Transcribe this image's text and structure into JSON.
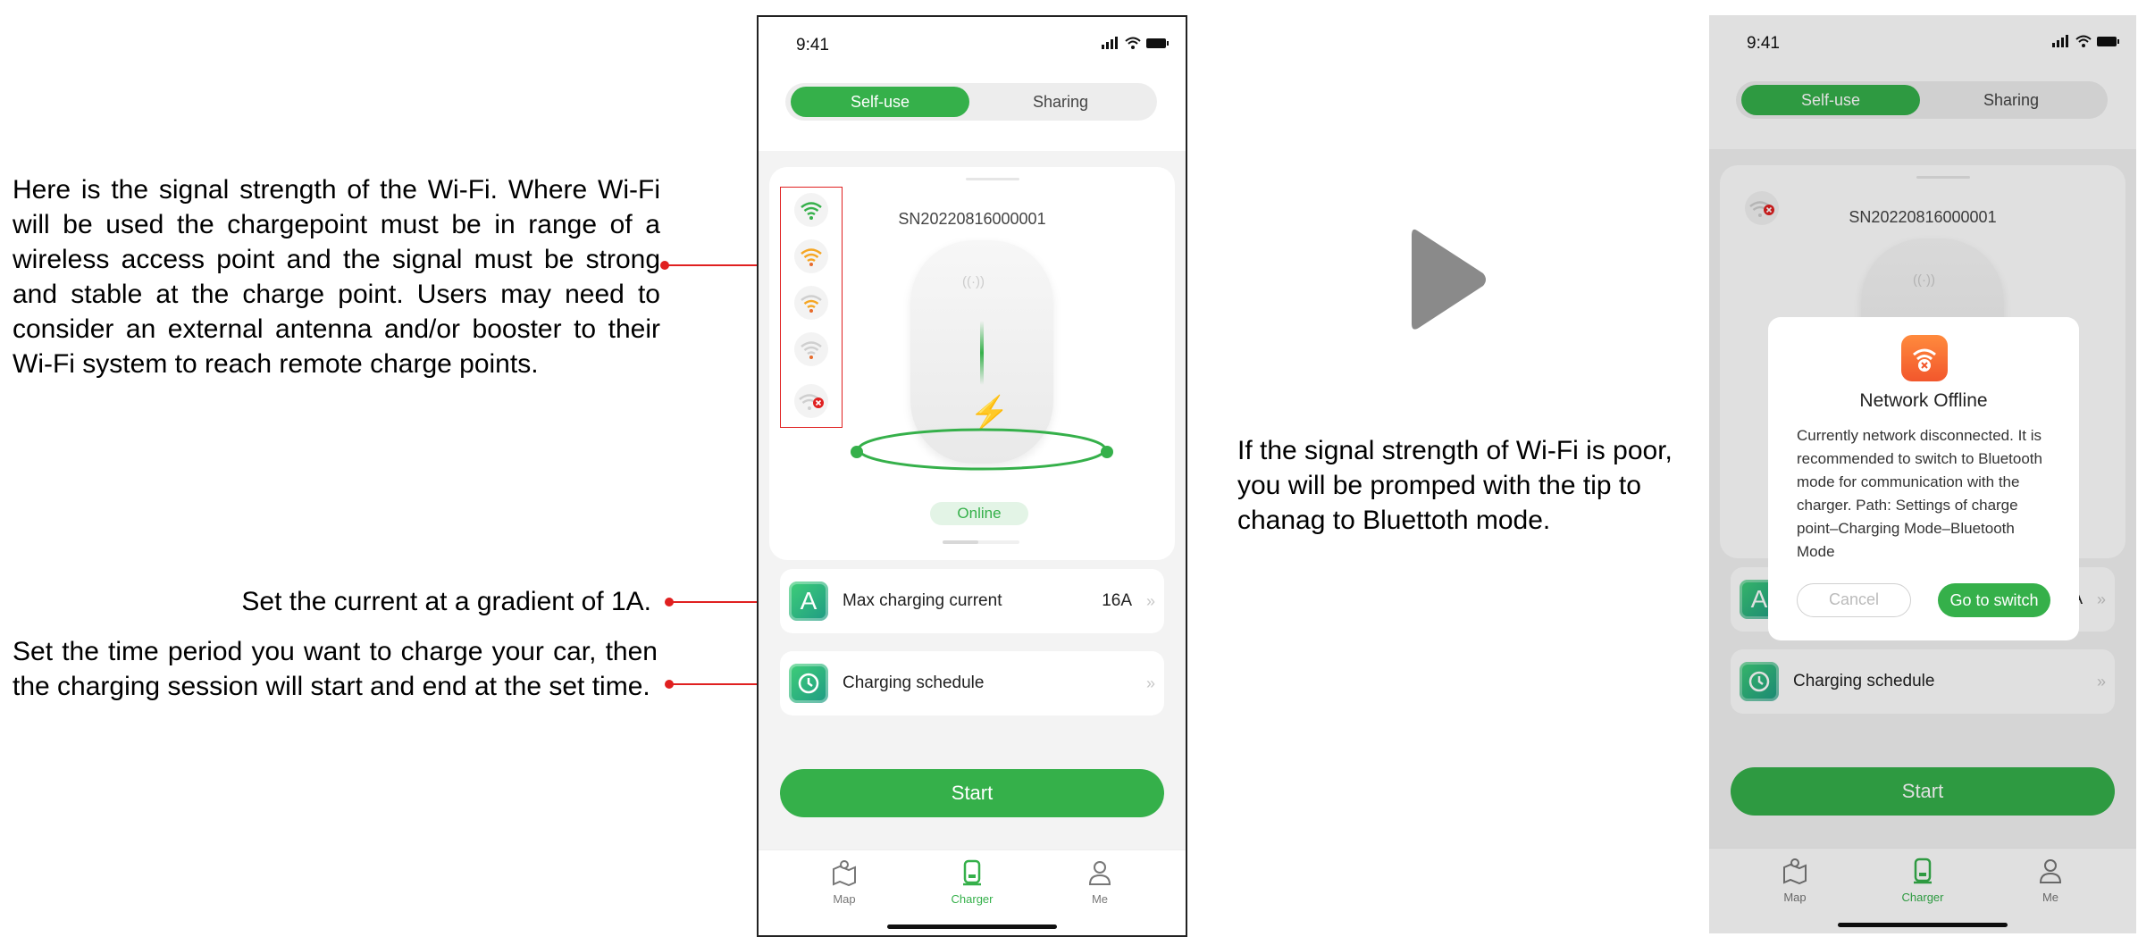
{
  "annotations": {
    "wifi": "Here is the signal strength of the Wi-Fi. Where Wi-Fi will be used the chargepoint must be in range of a wireless access point and the signal must be strong and stable at the charge point. Users may need to consider an external antenna and/or booster to their Wi-Fi system to reach remote charge points.",
    "current": "Set the current at a gradient of 1A.",
    "schedule": "Set the time period you want to charge your car, then the charging session will start and end at the set time.",
    "offline": "If the signal strength of Wi-Fi is poor,  you will be promped with the tip to chanag to Bluettoth mode."
  },
  "phone": {
    "time": "9:41",
    "segments": {
      "self_use": "Self-use",
      "sharing": "Sharing"
    },
    "serial": "SN20220816000001",
    "status": "Online",
    "max_current_label": "Max charging current",
    "max_current_value": "16A",
    "max_current_icon_letter": "A",
    "schedule_label": "Charging schedule",
    "chevron": "»",
    "start_label": "Start",
    "tabs": {
      "map": "Map",
      "charger": "Charger",
      "me": "Me"
    }
  },
  "dialog": {
    "title": "Network Offline",
    "body": "Currently network disconnected. It is recommended to switch to Bluetooth mode for communication with the charger. Path: Settings of charge point–Charging Mode–Bluetooth Mode",
    "cancel": "Cancel",
    "confirm": "Go to switch"
  },
  "wifi_levels": [
    "strong",
    "good",
    "fair",
    "weak",
    "disconnected"
  ],
  "colors": {
    "accent": "#35b04a",
    "annotation_line": "#e02020",
    "dialog_icon": "#f2572c"
  }
}
